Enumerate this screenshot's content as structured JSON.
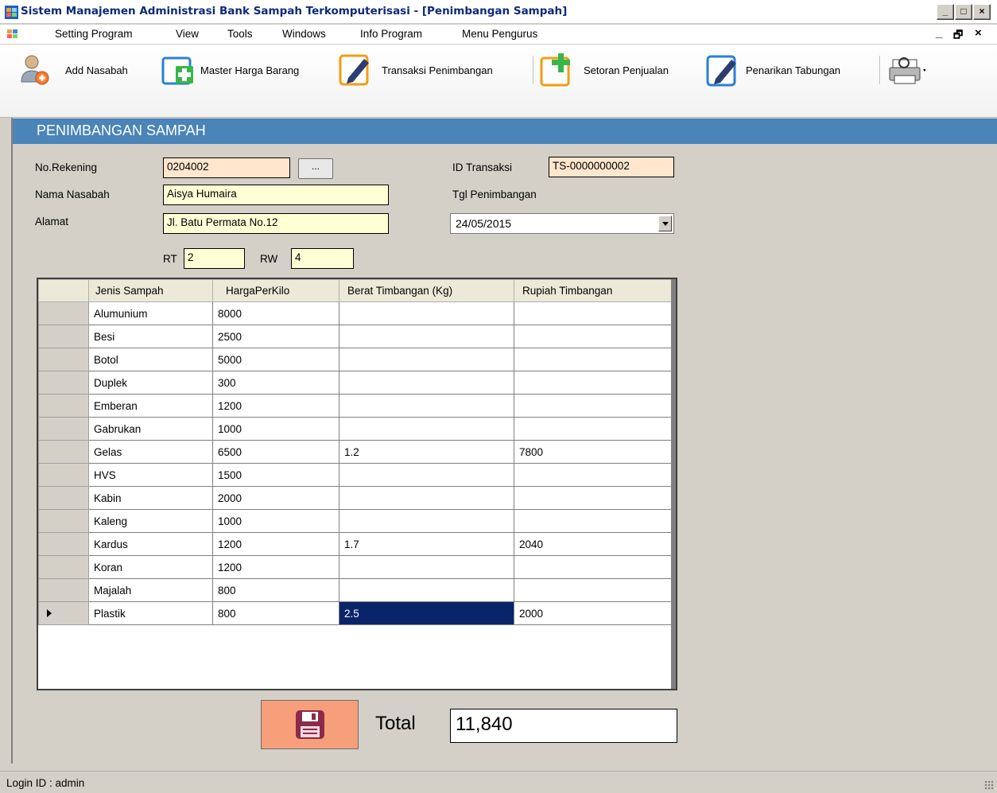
{
  "window": {
    "title": "Sistem Manajemen Administrasi Bank Sampah Terkomputerisasi - [Penimbangan Sampah]",
    "minimize": "_",
    "maximize": "□",
    "close": "×"
  },
  "menu": {
    "items": [
      "Setting Program",
      "View",
      "Tools",
      "Windows",
      "Info Program",
      "Menu Pengurus"
    ],
    "mdi_minimize": "_",
    "mdi_restore": "🗗",
    "mdi_close": "×"
  },
  "toolbar": {
    "add_nasabah": "Add Nasabah",
    "master_harga": "Master Harga Barang",
    "transaksi": "Transaksi Penimbangan",
    "setoran": "Setoran Penjualan",
    "penarikan": "Penarikan Tabungan"
  },
  "form": {
    "header": "PENIMBANGAN SAMPAH",
    "no_rekening_label": "No.Rekening",
    "no_rekening": "0204002",
    "browse": "...",
    "nama_label": "Nama Nasabah",
    "nama": "Aisya Humaira",
    "alamat_label": "Alamat",
    "alamat": "Jl. Batu Permata No.12",
    "rt_label": "RT",
    "rt": "2",
    "rw_label": "RW",
    "rw": "4",
    "id_transaksi_label": "ID Transaksi",
    "id_transaksi": "TS-0000000002",
    "tgl_label": "Tgl Penimbangan",
    "tgl": "24/05/2015"
  },
  "grid": {
    "columns": [
      "Jenis Sampah",
      "HargaPerKilo",
      "Berat Timbangan (Kg)",
      "Rupiah Timbangan"
    ],
    "rows": [
      [
        "Alumunium",
        "8000",
        "",
        ""
      ],
      [
        "Besi",
        "2500",
        "",
        ""
      ],
      [
        "Botol",
        "5000",
        "",
        ""
      ],
      [
        "Duplek",
        "300",
        "",
        ""
      ],
      [
        "Emberan",
        "1200",
        "",
        ""
      ],
      [
        "Gabrukan",
        "1000",
        "",
        ""
      ],
      [
        "Gelas",
        "6500",
        "1.2",
        "7800"
      ],
      [
        "HVS",
        "1500",
        "",
        ""
      ],
      [
        "Kabin",
        "2000",
        "",
        ""
      ],
      [
        "Kaleng",
        "1000",
        "",
        ""
      ],
      [
        "Kardus",
        "1200",
        "1.7",
        "2040"
      ],
      [
        "Koran",
        "1200",
        "",
        ""
      ],
      [
        "Majalah",
        "800",
        "",
        ""
      ],
      [
        "Plastik",
        "800",
        "2.5",
        "2000"
      ]
    ]
  },
  "total_label": "Total",
  "total": "11,840",
  "status": "Login ID :  admin",
  "colors": {
    "header_bar": "#4a84b8",
    "save_button": "#f79f7a",
    "selected_cell": "#0a246a"
  }
}
